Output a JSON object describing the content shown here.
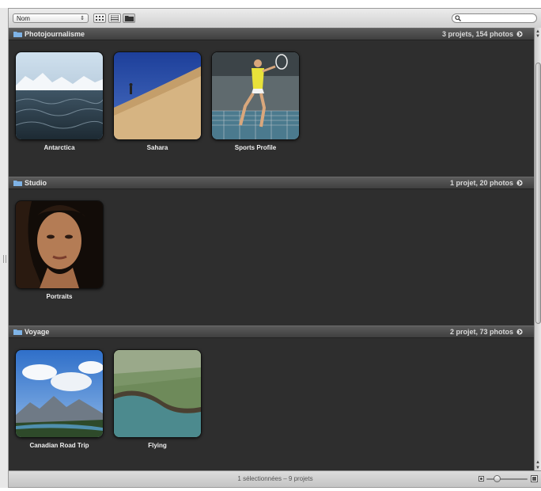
{
  "toolbar": {
    "sort_value": "Nom",
    "view_buttons": [
      "grid-view-icon",
      "list-view-icon",
      "folder-view-icon"
    ],
    "search_placeholder": ""
  },
  "sections": [
    {
      "title": "Photojournalisme",
      "count": "3 projets, 154 photos",
      "projects": [
        {
          "label": "Antarctica",
          "icon": "antarctica-photo"
        },
        {
          "label": "Sahara",
          "icon": "sahara-photo"
        },
        {
          "label": "Sports Profile",
          "icon": "tennis-photo"
        }
      ]
    },
    {
      "title": "Studio",
      "count": "1 projet, 20 photos",
      "projects": [
        {
          "label": "Portraits",
          "icon": "portrait-photo"
        }
      ]
    },
    {
      "title": "Voyage",
      "count": "2 projet, 73 photos",
      "projects": [
        {
          "label": "Canadian Road Trip",
          "icon": "mountains-photo"
        },
        {
          "label": "Flying",
          "icon": "aerial-coast-photo"
        }
      ]
    }
  ],
  "footer": {
    "status": "1 sélectionnées – 9 projets",
    "zoom_level": 0.2
  }
}
